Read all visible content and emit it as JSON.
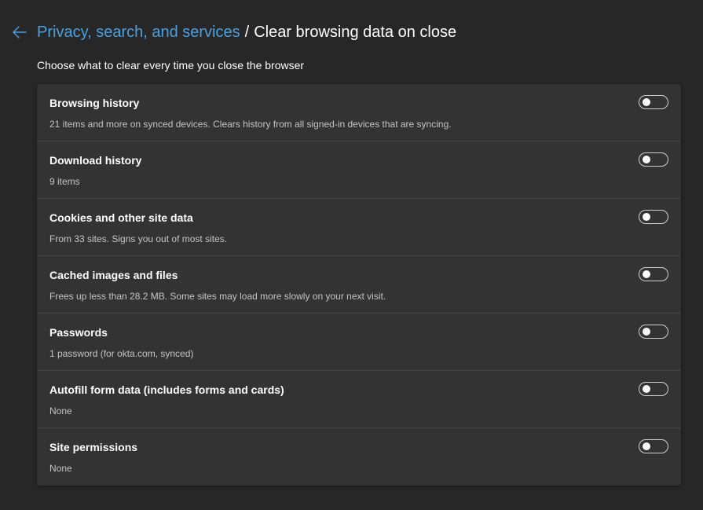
{
  "header": {
    "back_icon": "arrow-left-icon",
    "breadcrumb_parent": "Privacy, search, and services",
    "breadcrumb_separator": "/",
    "breadcrumb_current": "Clear browsing data on close"
  },
  "subtitle": "Choose what to clear every time you close the browser",
  "options": [
    {
      "title": "Browsing history",
      "description": "21 items and more on synced devices. Clears history from all signed-in devices that are syncing.",
      "enabled": false
    },
    {
      "title": "Download history",
      "description": "9 items",
      "enabled": false
    },
    {
      "title": "Cookies and other site data",
      "description": "From 33 sites. Signs you out of most sites.",
      "enabled": false
    },
    {
      "title": "Cached images and files",
      "description": "Frees up less than 28.2 MB. Some sites may load more slowly on your next visit.",
      "enabled": false
    },
    {
      "title": "Passwords",
      "description": "1 password (for okta.com, synced)",
      "enabled": false
    },
    {
      "title": "Autofill form data (includes forms and cards)",
      "description": "None",
      "enabled": false
    },
    {
      "title": "Site permissions",
      "description": "None",
      "enabled": false
    }
  ],
  "colors": {
    "background": "#272727",
    "card": "#333333",
    "link": "#4ba0e0",
    "text": "#ffffff",
    "secondary_text": "#c4c4c4"
  }
}
